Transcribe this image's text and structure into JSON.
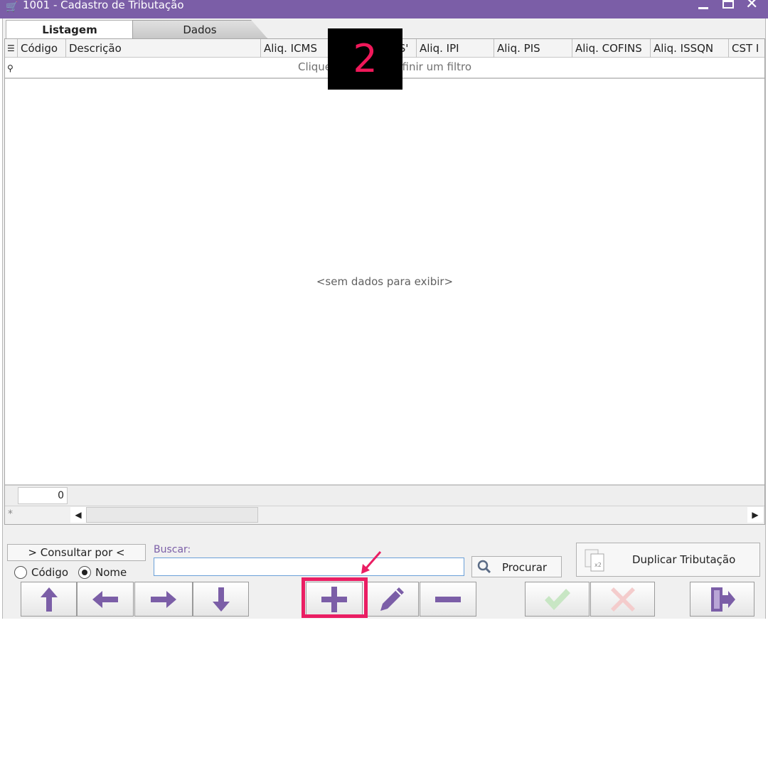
{
  "window": {
    "title": "1001 - Cadastro de Tributação",
    "app_icon": "shopping-cart-icon",
    "controls": [
      "minimize-icon",
      "maximize-icon",
      "close-icon"
    ]
  },
  "tabs": [
    {
      "label": "Listagem",
      "active": true
    },
    {
      "label": "Dados",
      "active": false
    }
  ],
  "grid": {
    "columns": [
      "Código",
      "Descrição",
      "Aliq. ICMS",
      "Aliq. ICMS S'",
      "Aliq. IPI",
      "Aliq. PIS",
      "Aliq. COFINS",
      "Aliq. ISSQN",
      "CST I"
    ],
    "filter_hint": "Clique aqui para definir um filtro",
    "empty_message": "<sem dados para exibir>",
    "record_count": "0"
  },
  "overlay": {
    "step_number": "2",
    "step_color": "#f0185a",
    "highlight_color": "#ea1e63"
  },
  "search": {
    "consultar_label": "> Consultar por <",
    "radio_options": [
      {
        "label": "Código",
        "selected": false
      },
      {
        "label": "Nome",
        "selected": true
      }
    ],
    "buscar_label": "Buscar:",
    "input_value": "",
    "procurar_label": "Procurar",
    "duplicar_label": "Duplicar Tributação"
  },
  "toolbar": {
    "buttons": [
      {
        "icon": "arrow-up-icon",
        "enabled": true
      },
      {
        "icon": "arrow-left-icon",
        "enabled": true
      },
      {
        "icon": "arrow-right-icon",
        "enabled": true
      },
      {
        "icon": "arrow-down-icon",
        "enabled": true
      },
      {
        "icon": "plus-icon",
        "enabled": true,
        "highlighted": true
      },
      {
        "icon": "pencil-icon",
        "enabled": true
      },
      {
        "icon": "minus-icon",
        "enabled": true
      },
      {
        "icon": "check-icon",
        "enabled": false
      },
      {
        "icon": "x-icon",
        "enabled": false
      },
      {
        "icon": "exit-icon",
        "enabled": true
      }
    ]
  },
  "colors": {
    "accent": "#7b5ea7",
    "icon": "#7b5ea7",
    "disabled_check": "#c8e6c4",
    "disabled_x": "#f4cccc"
  }
}
